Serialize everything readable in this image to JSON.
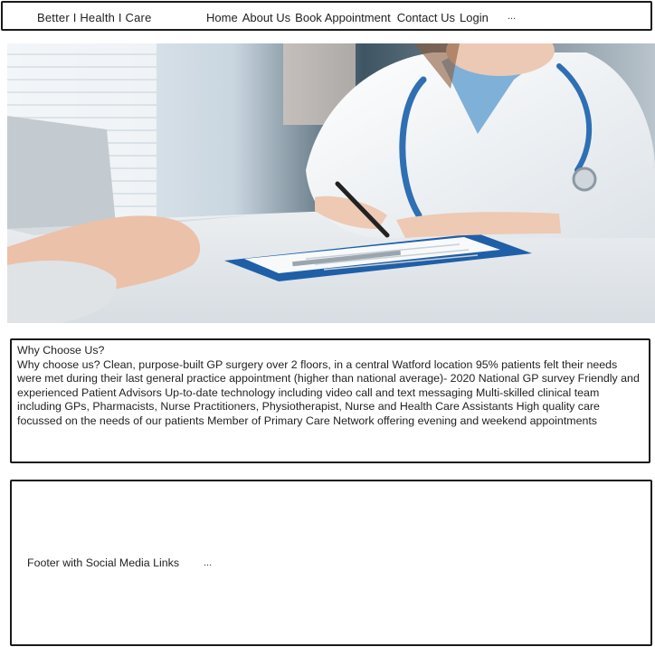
{
  "header": {
    "brand": "Better I Health I Care",
    "nav": [
      {
        "label": "Home"
      },
      {
        "label": "About Us"
      },
      {
        "label": "Book Appointment"
      },
      {
        "label": "Contact Us"
      },
      {
        "label": "Login"
      }
    ],
    "more": "..."
  },
  "hero": {
    "image_subject": "doctor-writing-on-clipboard-with-patient"
  },
  "why": {
    "title": "Why Choose Us?",
    "body": "Why choose us? Clean, purpose-built GP surgery over 2 floors, in a central Watford location 95% patients felt their needs were met during their last general practice appointment (higher than national average)- 2020 National GP survey Friendly and experienced Patient Advisors Up-to-date technology including video call and text messaging Multi-skilled clinical team including GPs, Pharmacists, Nurse Practitioners, Physiotherapist, Nurse and Health Care Assistants High quality care focussed on the needs of our patients Member of Primary Care Network offering evening and weekend appointments"
  },
  "footer": {
    "label": "Footer with Social Media Links",
    "more": "..."
  },
  "colors": {
    "border": "#1a1a1a",
    "text": "#222222",
    "coat": "#f4f6f8",
    "stethoscope": "#2f6fb3",
    "clipboard": "#1f5fa8"
  }
}
